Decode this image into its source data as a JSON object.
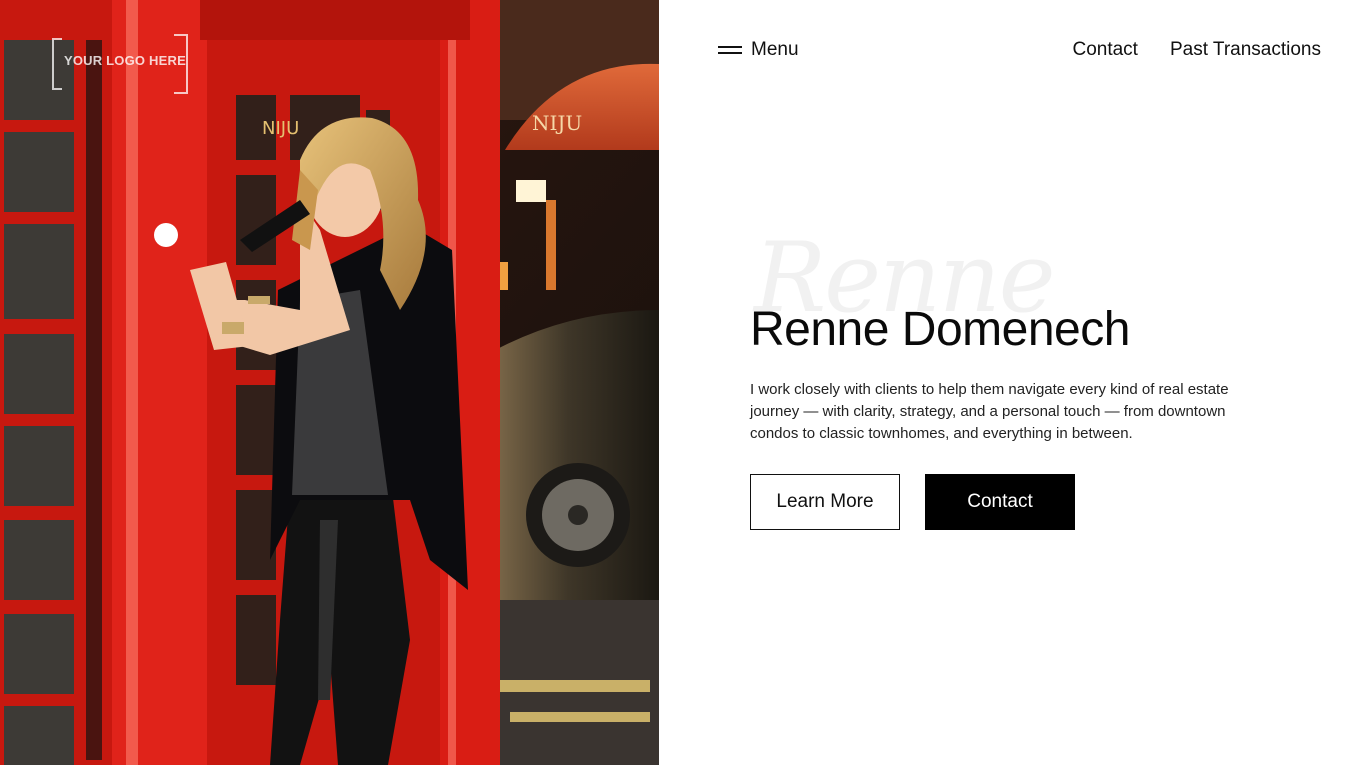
{
  "logo": {
    "text": "YOUR LOGO HERE"
  },
  "header": {
    "menu_label": "Menu",
    "links": [
      {
        "label": "Contact"
      },
      {
        "label": "Past Transactions"
      }
    ]
  },
  "hero": {
    "script_word": "Renne",
    "name": "Renne Domenech",
    "bio": "I work closely with clients to help them navigate every kind of real estate journey — with clarity, strategy, and a personal touch — from downtown condos to classic townhomes, and everything in between.",
    "buttons": {
      "learn_more": "Learn More",
      "contact": "Contact"
    }
  },
  "photo": {
    "sign_text": "NIJU",
    "awning_text": "NIJU"
  },
  "colors": {
    "phone_booth_red": "#d8201a",
    "accent_black": "#000000",
    "background": "#ffffff"
  }
}
